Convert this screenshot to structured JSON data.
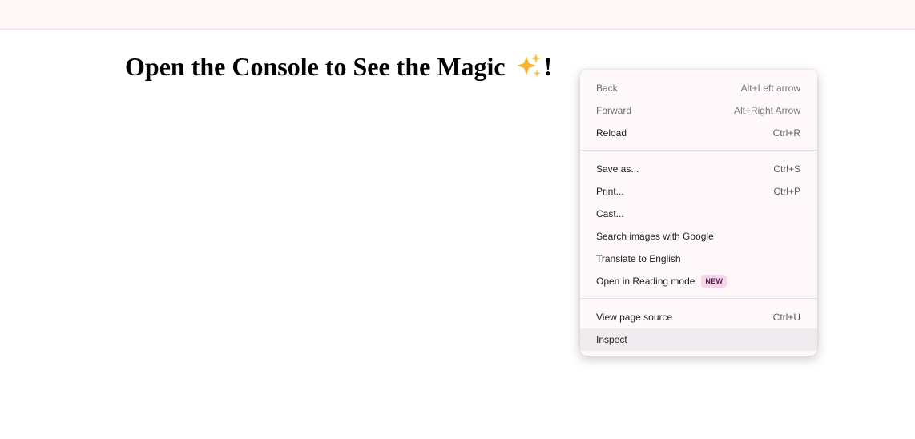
{
  "page": {
    "heading_text": "Open the Console to See the Magic",
    "heading_emoji_name": "sparkles-icon",
    "heading_suffix": "!"
  },
  "context_menu": {
    "groups": [
      {
        "items": [
          {
            "label": "Back",
            "shortcut": "Alt+Left arrow",
            "disabled": true
          },
          {
            "label": "Forward",
            "shortcut": "Alt+Right Arrow",
            "disabled": true
          },
          {
            "label": "Reload",
            "shortcut": "Ctrl+R",
            "disabled": false
          }
        ]
      },
      {
        "items": [
          {
            "label": "Save as...",
            "shortcut": "Ctrl+S",
            "disabled": false
          },
          {
            "label": "Print...",
            "shortcut": "Ctrl+P",
            "disabled": false
          },
          {
            "label": "Cast...",
            "shortcut": "",
            "disabled": false
          },
          {
            "label": "Search images with Google",
            "shortcut": "",
            "disabled": false
          },
          {
            "label": "Translate to English",
            "shortcut": "",
            "disabled": false
          },
          {
            "label": "Open in Reading mode",
            "shortcut": "",
            "badge": "NEW",
            "disabled": false
          }
        ]
      },
      {
        "items": [
          {
            "label": "View page source",
            "shortcut": "Ctrl+U",
            "disabled": false
          },
          {
            "label": "Inspect",
            "shortcut": "",
            "disabled": false,
            "hovered": true
          }
        ]
      }
    ]
  },
  "colors": {
    "topbar_bg": "#fdf7f7",
    "menu_bg": "#fef8fb",
    "menu_hover_bg": "#efebee",
    "badge_bg": "#f6d4ea",
    "badge_text": "#5a1b4a",
    "sparkle": "#f5b52e"
  }
}
